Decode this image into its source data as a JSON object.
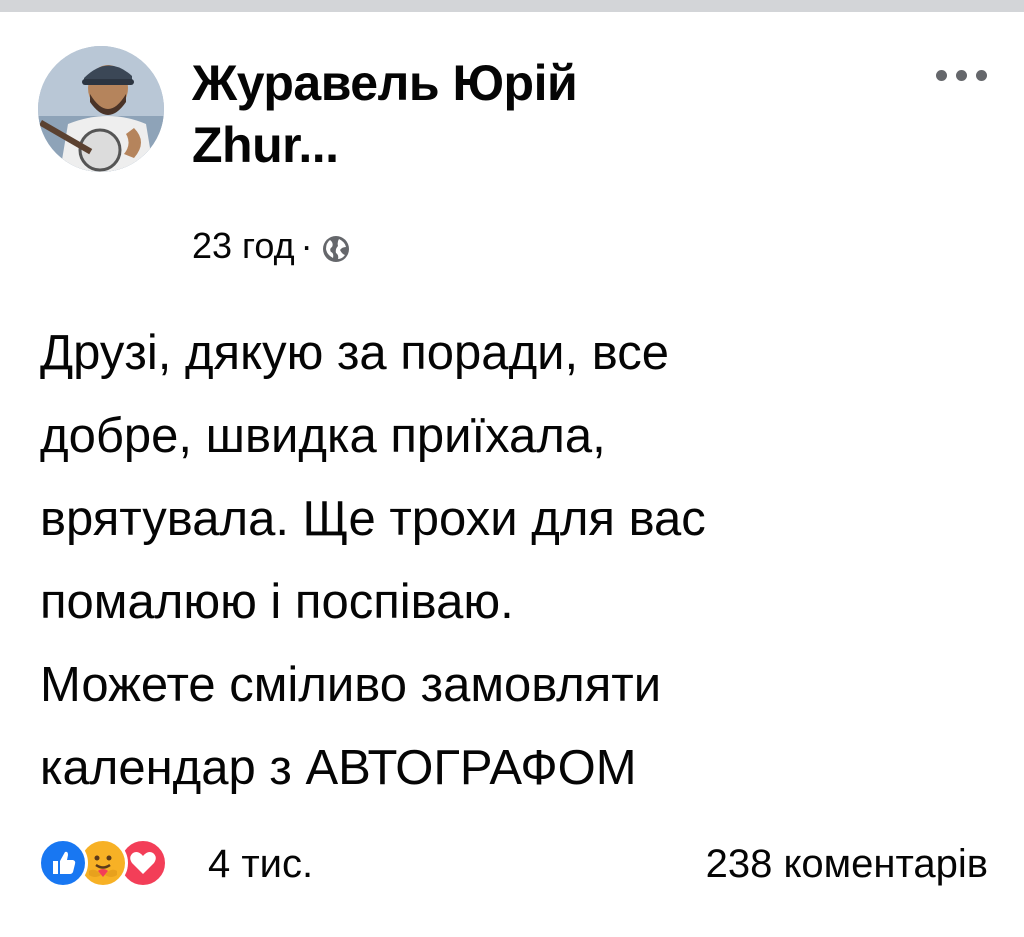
{
  "post": {
    "author": {
      "name": "Журавель Юрій\nZhur...",
      "avatar_icon": "user-photo"
    },
    "meta": {
      "time": "23 год",
      "separator": "·",
      "privacy_icon": "globe-icon"
    },
    "more_icon": "more-horizontal-icon",
    "text": "Друзі, дякую за поради, все\nдобре, швидка приїхала,\nврятувала. Ще трохи для вас\nпомалюю і поспіваю.\nМожете сміливо замовляти\nкалендар з АВТОГРАФОМ",
    "reactions": {
      "icons": [
        "like-icon",
        "care-icon",
        "love-icon"
      ],
      "count": "4 тис."
    },
    "comments": {
      "count": "238 коментарів"
    }
  },
  "colors": {
    "top_strip": "#d3d5d8",
    "text": "#050505",
    "secondary": "#65676b",
    "like_blue": "#1877f2",
    "love_red": "#f33e58",
    "care_yellow": "#f7b125"
  }
}
